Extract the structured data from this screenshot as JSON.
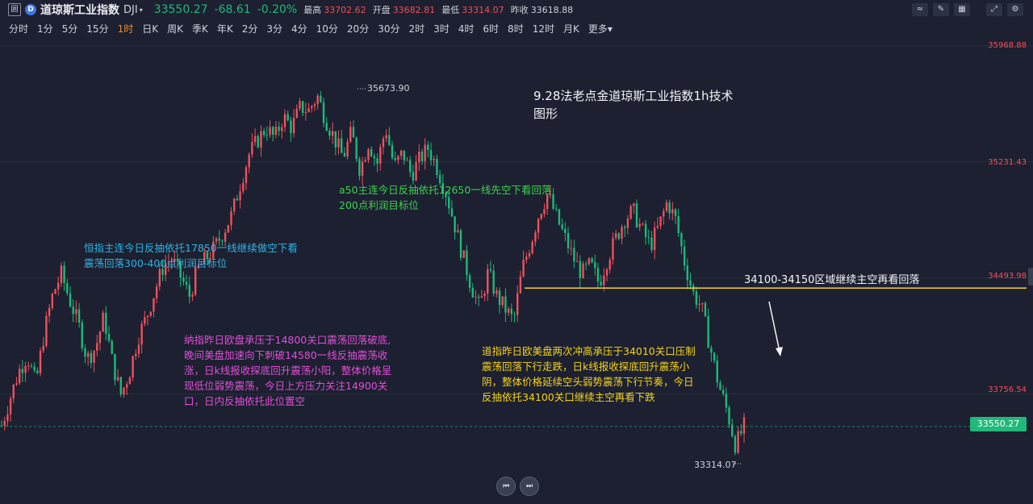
{
  "header": {
    "box_glyph": "囲",
    "logo_glyph": "D",
    "name": "道琼斯工业指数",
    "code": "DJI",
    "dropdown_glyph": "▾",
    "price": "33550.27",
    "change": "-68.61",
    "change_pct": "-0.20%",
    "high_label": "最高",
    "high": "33702.62",
    "open_label": "开盘",
    "open": "33682.81",
    "low_label": "最低",
    "low": "33314.07",
    "prev_label": "昨收",
    "prev": "33618.88",
    "colors": {
      "up": "#f0505c",
      "down": "#1fb97a",
      "accent": "#f58a2e"
    }
  },
  "toolbar": [
    {
      "icon": "line-chart-icon",
      "glyph": "≈"
    },
    {
      "icon": "pen-icon",
      "glyph": "✎"
    },
    {
      "icon": "grid-icon",
      "glyph": "▦"
    },
    {
      "icon": "expand-icon",
      "glyph": "⤢"
    },
    {
      "icon": "settings-icon",
      "glyph": "⚙"
    }
  ],
  "periods": [
    {
      "label": "分时",
      "active": false
    },
    {
      "label": "1分",
      "active": false
    },
    {
      "label": "5分",
      "active": false
    },
    {
      "label": "15分",
      "active": false
    },
    {
      "label": "1时",
      "active": true
    },
    {
      "label": "日K",
      "active": false
    },
    {
      "label": "周K",
      "active": false
    },
    {
      "label": "季K",
      "active": false
    },
    {
      "label": "年K",
      "active": false
    },
    {
      "label": "2分",
      "active": false
    },
    {
      "label": "3分",
      "active": false
    },
    {
      "label": "4分",
      "active": false
    },
    {
      "label": "10分",
      "active": false
    },
    {
      "label": "20分",
      "active": false
    },
    {
      "label": "30分",
      "active": false
    },
    {
      "label": "2时",
      "active": false
    },
    {
      "label": "3时",
      "active": false
    },
    {
      "label": "4时",
      "active": false
    },
    {
      "label": "6时",
      "active": false
    },
    {
      "label": "8时",
      "active": false
    },
    {
      "label": "12时",
      "active": false
    },
    {
      "label": "月K",
      "active": false
    },
    {
      "label": "更多▾",
      "active": false
    }
  ],
  "chart_data": {
    "type": "candlestick",
    "title": "9.28法老点金道琼斯工业指数1h技术图形",
    "y_axis_labels": [
      "35968.88",
      "35231.43",
      "34493.98",
      "33756.54"
    ],
    "ylim": [
      33314.07,
      35968.88
    ],
    "last_price": "33550.27",
    "max_label": "35673.90",
    "min_label": "33314.07",
    "horizontal_line": {
      "level": 34430,
      "label": "34100-34150区域继续主空再看回落",
      "color": "#f5d31e"
    },
    "close_path": [
      33556,
      33730,
      33900,
      34000,
      33820,
      34150,
      34390,
      34520,
      34350,
      34200,
      33980,
      34050,
      34250,
      33950,
      33750,
      33900,
      34120,
      34250,
      34420,
      34580,
      34610,
      34500,
      34380,
      34550,
      34620,
      34690,
      34790,
      34900,
      35100,
      35280,
      35370,
      35450,
      35380,
      35520,
      35450,
      35580,
      35560,
      35650,
      35500,
      35380,
      35260,
      35420,
      35180,
      35360,
      35220,
      35450,
      35200,
      35290,
      35150,
      35250,
      35320,
      35200,
      35050,
      34850,
      34640,
      34450,
      34300,
      34530,
      34380,
      34300,
      34220,
      34550,
      34720,
      34910,
      35030,
      34880,
      34750,
      34620,
      34520,
      34580,
      34460,
      34620,
      34750,
      34870,
      34920,
      34800,
      34700,
      34820,
      34980,
      34860,
      34600,
      34400,
      34310,
      34060,
      33820,
      33650,
      33430,
      33550
    ],
    "annotations": {
      "title_line1": "9.28法老点金道琼斯工业指数1h技术",
      "title_line2": "图形",
      "hsi_line1": "恒指主连今日反抽依托17850一线继续做空下看",
      "hsi_line2": "震荡回落300-400点利润目标位",
      "a50_line1": "a50主连今日反抽依托12650一线先空下看回落",
      "a50_line2": "200点利润目标位",
      "nas_line1": "纳指昨日欧盘承压于14800关口震荡回落破底,",
      "nas_line2": "晚间美盘加速向下刺破14580一线反抽震荡收",
      "nas_line3": "涨，日k线报收探底回升震荡小阳，整体价格呈",
      "nas_line4": "现低位弱势震荡，今日上方压力关注14900关",
      "nas_line5": "口，日内反抽依托此位置空",
      "dji_line1": "道指昨日欧美盘两次冲高承压于34010关口压制",
      "dji_line2": "震荡回落下行走跌，日k线报收探底回升震荡小",
      "dji_line3": "阴，整体价格延续空头弱势震荡下行节奏，今日",
      "dji_line4": "反抽依托34100关口继续主空再看下跌"
    }
  },
  "nav": {
    "prev_glyph": "⏮",
    "next_glyph": "⏭"
  }
}
